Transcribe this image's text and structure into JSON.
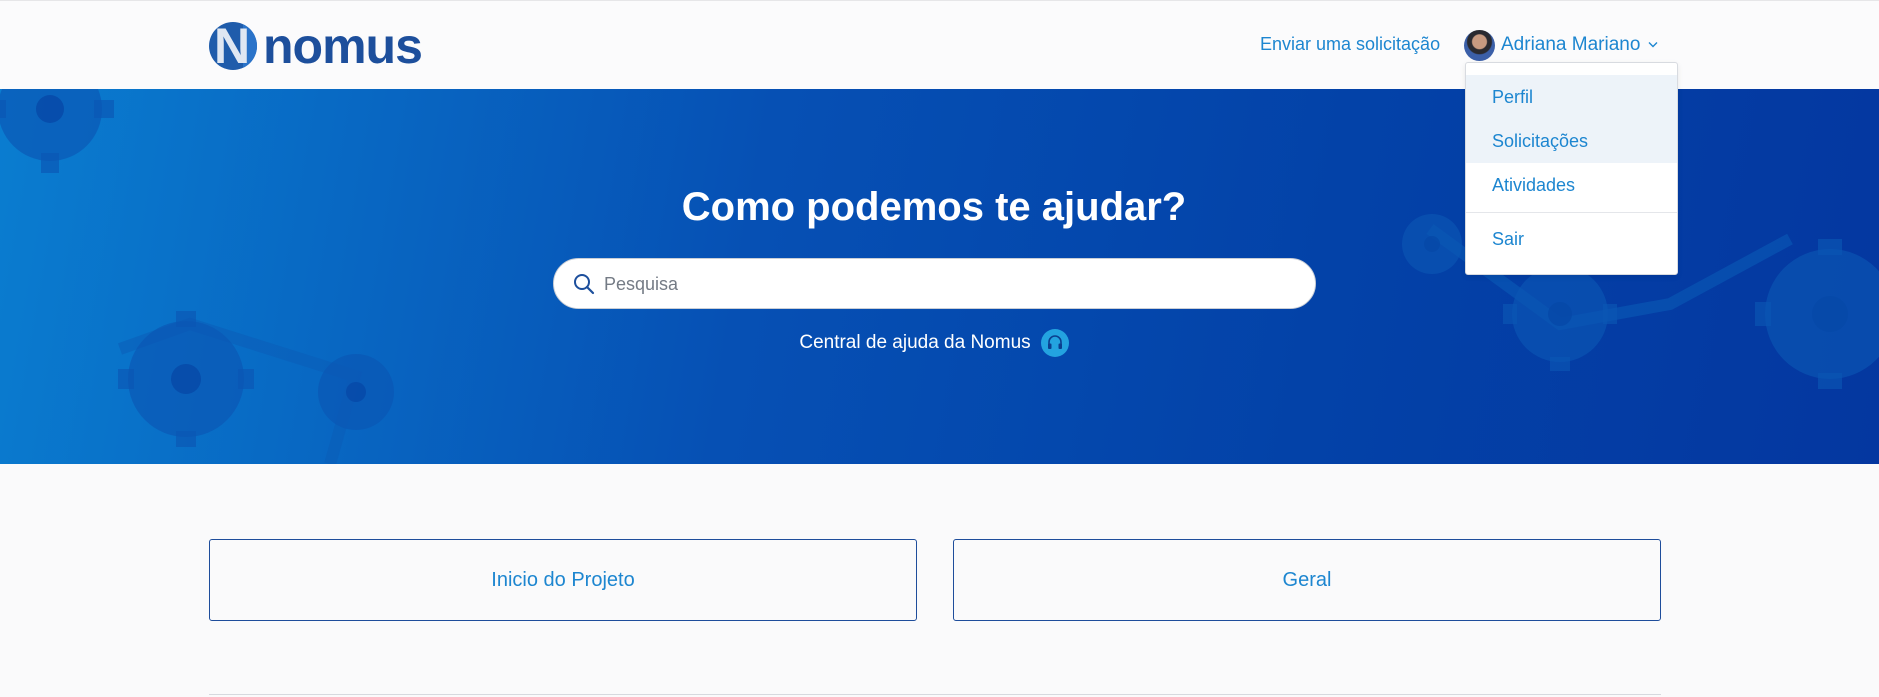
{
  "header": {
    "logo_text": "nomus",
    "logo_letter": "N",
    "submit_request_label": "Enviar uma solicitação",
    "user_name": "Adriana Mariano"
  },
  "user_menu": {
    "items": [
      {
        "label": "Perfil",
        "highlighted": true
      },
      {
        "label": "Solicitações",
        "highlighted": true
      },
      {
        "label": "Atividades",
        "highlighted": false
      },
      {
        "label": "Sair",
        "highlighted": false
      }
    ]
  },
  "hero": {
    "title": "Como podemos te ajudar?",
    "search_placeholder": "Pesquisa",
    "tagline": "Central de ajuda da Nomus"
  },
  "categories": [
    {
      "label": "Inicio do Projeto"
    },
    {
      "label": "Geral"
    }
  ],
  "colors": {
    "brand_blue": "#1d4f9c",
    "link_blue": "#1d86d0",
    "hero_start": "#0a7dd0",
    "hero_end": "#0437a0"
  }
}
